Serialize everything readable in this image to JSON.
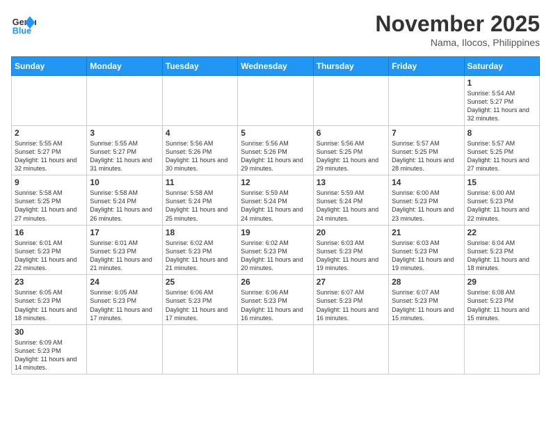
{
  "header": {
    "logo_general": "General",
    "logo_blue": "Blue",
    "month_title": "November 2025",
    "location": "Nama, Ilocos, Philippines"
  },
  "weekdays": [
    "Sunday",
    "Monday",
    "Tuesday",
    "Wednesday",
    "Thursday",
    "Friday",
    "Saturday"
  ],
  "weeks": [
    [
      {
        "day": "",
        "sunrise": "",
        "sunset": "",
        "daylight": ""
      },
      {
        "day": "",
        "sunrise": "",
        "sunset": "",
        "daylight": ""
      },
      {
        "day": "",
        "sunrise": "",
        "sunset": "",
        "daylight": ""
      },
      {
        "day": "",
        "sunrise": "",
        "sunset": "",
        "daylight": ""
      },
      {
        "day": "",
        "sunrise": "",
        "sunset": "",
        "daylight": ""
      },
      {
        "day": "",
        "sunrise": "",
        "sunset": "",
        "daylight": ""
      },
      {
        "day": "1",
        "sunrise": "Sunrise: 5:54 AM",
        "sunset": "Sunset: 5:27 PM",
        "daylight": "Daylight: 11 hours and 32 minutes."
      }
    ],
    [
      {
        "day": "2",
        "sunrise": "Sunrise: 5:55 AM",
        "sunset": "Sunset: 5:27 PM",
        "daylight": "Daylight: 11 hours and 32 minutes."
      },
      {
        "day": "3",
        "sunrise": "Sunrise: 5:55 AM",
        "sunset": "Sunset: 5:27 PM",
        "daylight": "Daylight: 11 hours and 31 minutes."
      },
      {
        "day": "4",
        "sunrise": "Sunrise: 5:56 AM",
        "sunset": "Sunset: 5:26 PM",
        "daylight": "Daylight: 11 hours and 30 minutes."
      },
      {
        "day": "5",
        "sunrise": "Sunrise: 5:56 AM",
        "sunset": "Sunset: 5:26 PM",
        "daylight": "Daylight: 11 hours and 29 minutes."
      },
      {
        "day": "6",
        "sunrise": "Sunrise: 5:56 AM",
        "sunset": "Sunset: 5:25 PM",
        "daylight": "Daylight: 11 hours and 29 minutes."
      },
      {
        "day": "7",
        "sunrise": "Sunrise: 5:57 AM",
        "sunset": "Sunset: 5:25 PM",
        "daylight": "Daylight: 11 hours and 28 minutes."
      },
      {
        "day": "8",
        "sunrise": "Sunrise: 5:57 AM",
        "sunset": "Sunset: 5:25 PM",
        "daylight": "Daylight: 11 hours and 27 minutes."
      }
    ],
    [
      {
        "day": "9",
        "sunrise": "Sunrise: 5:58 AM",
        "sunset": "Sunset: 5:25 PM",
        "daylight": "Daylight: 11 hours and 27 minutes."
      },
      {
        "day": "10",
        "sunrise": "Sunrise: 5:58 AM",
        "sunset": "Sunset: 5:24 PM",
        "daylight": "Daylight: 11 hours and 26 minutes."
      },
      {
        "day": "11",
        "sunrise": "Sunrise: 5:58 AM",
        "sunset": "Sunset: 5:24 PM",
        "daylight": "Daylight: 11 hours and 25 minutes."
      },
      {
        "day": "12",
        "sunrise": "Sunrise: 5:59 AM",
        "sunset": "Sunset: 5:24 PM",
        "daylight": "Daylight: 11 hours and 24 minutes."
      },
      {
        "day": "13",
        "sunrise": "Sunrise: 5:59 AM",
        "sunset": "Sunset: 5:24 PM",
        "daylight": "Daylight: 11 hours and 24 minutes."
      },
      {
        "day": "14",
        "sunrise": "Sunrise: 6:00 AM",
        "sunset": "Sunset: 5:23 PM",
        "daylight": "Daylight: 11 hours and 23 minutes."
      },
      {
        "day": "15",
        "sunrise": "Sunrise: 6:00 AM",
        "sunset": "Sunset: 5:23 PM",
        "daylight": "Daylight: 11 hours and 22 minutes."
      }
    ],
    [
      {
        "day": "16",
        "sunrise": "Sunrise: 6:01 AM",
        "sunset": "Sunset: 5:23 PM",
        "daylight": "Daylight: 11 hours and 22 minutes."
      },
      {
        "day": "17",
        "sunrise": "Sunrise: 6:01 AM",
        "sunset": "Sunset: 5:23 PM",
        "daylight": "Daylight: 11 hours and 21 minutes."
      },
      {
        "day": "18",
        "sunrise": "Sunrise: 6:02 AM",
        "sunset": "Sunset: 5:23 PM",
        "daylight": "Daylight: 11 hours and 21 minutes."
      },
      {
        "day": "19",
        "sunrise": "Sunrise: 6:02 AM",
        "sunset": "Sunset: 5:23 PM",
        "daylight": "Daylight: 11 hours and 20 minutes."
      },
      {
        "day": "20",
        "sunrise": "Sunrise: 6:03 AM",
        "sunset": "Sunset: 5:23 PM",
        "daylight": "Daylight: 11 hours and 19 minutes."
      },
      {
        "day": "21",
        "sunrise": "Sunrise: 6:03 AM",
        "sunset": "Sunset: 5:23 PM",
        "daylight": "Daylight: 11 hours and 19 minutes."
      },
      {
        "day": "22",
        "sunrise": "Sunrise: 6:04 AM",
        "sunset": "Sunset: 5:23 PM",
        "daylight": "Daylight: 11 hours and 18 minutes."
      }
    ],
    [
      {
        "day": "23",
        "sunrise": "Sunrise: 6:05 AM",
        "sunset": "Sunset: 5:23 PM",
        "daylight": "Daylight: 11 hours and 18 minutes."
      },
      {
        "day": "24",
        "sunrise": "Sunrise: 6:05 AM",
        "sunset": "Sunset: 5:23 PM",
        "daylight": "Daylight: 11 hours and 17 minutes."
      },
      {
        "day": "25",
        "sunrise": "Sunrise: 6:06 AM",
        "sunset": "Sunset: 5:23 PM",
        "daylight": "Daylight: 11 hours and 17 minutes."
      },
      {
        "day": "26",
        "sunrise": "Sunrise: 6:06 AM",
        "sunset": "Sunset: 5:23 PM",
        "daylight": "Daylight: 11 hours and 16 minutes."
      },
      {
        "day": "27",
        "sunrise": "Sunrise: 6:07 AM",
        "sunset": "Sunset: 5:23 PM",
        "daylight": "Daylight: 11 hours and 16 minutes."
      },
      {
        "day": "28",
        "sunrise": "Sunrise: 6:07 AM",
        "sunset": "Sunset: 5:23 PM",
        "daylight": "Daylight: 11 hours and 15 minutes."
      },
      {
        "day": "29",
        "sunrise": "Sunrise: 6:08 AM",
        "sunset": "Sunset: 5:23 PM",
        "daylight": "Daylight: 11 hours and 15 minutes."
      }
    ],
    [
      {
        "day": "30",
        "sunrise": "Sunrise: 6:09 AM",
        "sunset": "Sunset: 5:23 PM",
        "daylight": "Daylight: 11 hours and 14 minutes."
      },
      {
        "day": "",
        "sunrise": "",
        "sunset": "",
        "daylight": ""
      },
      {
        "day": "",
        "sunrise": "",
        "sunset": "",
        "daylight": ""
      },
      {
        "day": "",
        "sunrise": "",
        "sunset": "",
        "daylight": ""
      },
      {
        "day": "",
        "sunrise": "",
        "sunset": "",
        "daylight": ""
      },
      {
        "day": "",
        "sunrise": "",
        "sunset": "",
        "daylight": ""
      },
      {
        "day": "",
        "sunrise": "",
        "sunset": "",
        "daylight": ""
      }
    ]
  ]
}
